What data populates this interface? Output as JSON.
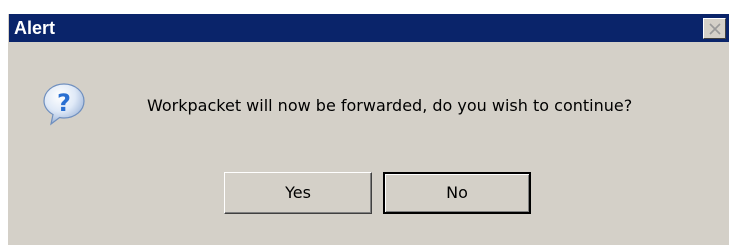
{
  "window": {
    "title": "Alert",
    "close_icon": "close-icon"
  },
  "dialog": {
    "icon": "question-icon",
    "message": "Workpacket will now be forwarded, do you wish to continue?"
  },
  "buttons": {
    "yes_label": "Yes",
    "no_label": "No",
    "default": "No"
  },
  "colors": {
    "titlebar": "#0a246a",
    "dialog_bg": "#d4d0c8",
    "icon_blue": "#2a6fd1"
  }
}
